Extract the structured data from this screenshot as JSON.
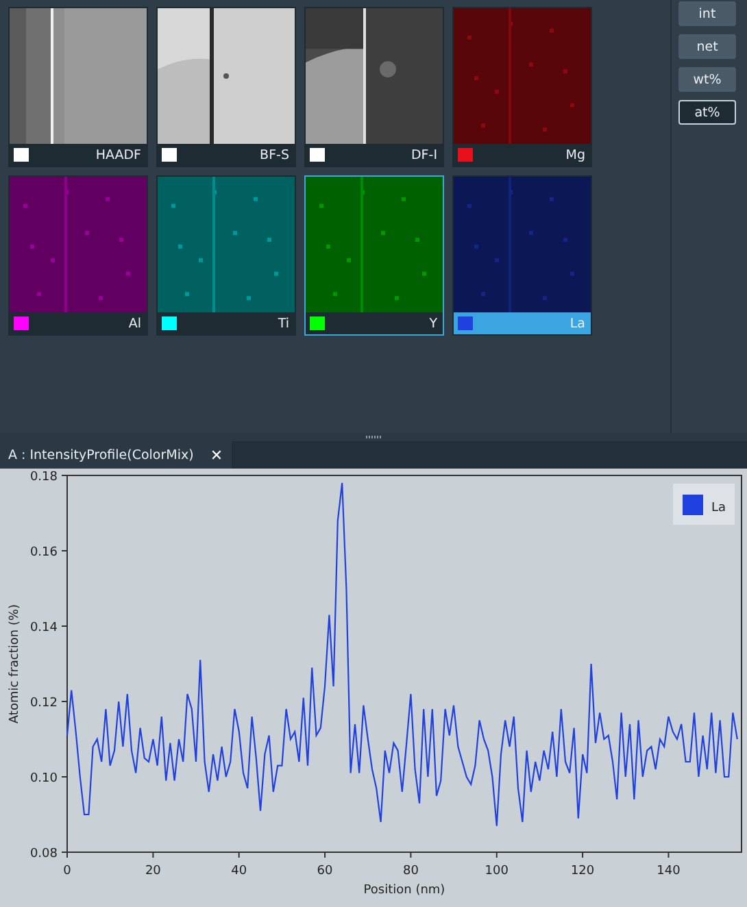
{
  "tiles": [
    {
      "label": "HAADF",
      "kind": "micrograph",
      "color": "#ffffff",
      "selected": false,
      "highlighted": false
    },
    {
      "label": "BF-S",
      "kind": "micrograph",
      "color": "#ffffff",
      "selected": false,
      "highlighted": false
    },
    {
      "label": "DF-I",
      "kind": "micrograph",
      "color": "#ffffff",
      "selected": false,
      "highlighted": false
    },
    {
      "label": "Mg",
      "kind": "element_map",
      "color": "#e8101a",
      "selected": false,
      "highlighted": false
    },
    {
      "label": "Al",
      "kind": "element_map",
      "color": "#ff00ff",
      "selected": false,
      "highlighted": false
    },
    {
      "label": "Ti",
      "kind": "element_map",
      "color": "#00ffff",
      "selected": false,
      "highlighted": false
    },
    {
      "label": "Y",
      "kind": "element_map",
      "color": "#00ff00",
      "selected": true,
      "highlighted": false
    },
    {
      "label": "La",
      "kind": "element_map",
      "color": "#2040e0",
      "selected": false,
      "highlighted": true
    }
  ],
  "sidebar": {
    "buttons": [
      {
        "label": "int",
        "selected": false
      },
      {
        "label": "net",
        "selected": false
      },
      {
        "label": "wt%",
        "selected": false
      },
      {
        "label": "at%",
        "selected": true
      }
    ]
  },
  "tab": {
    "title": "A : IntensityProfile(ColorMix)",
    "close": "✕"
  },
  "chart": {
    "chart_data": {
      "type": "line",
      "xlabel": "Position (nm)",
      "ylabel": "Atomic fraction (%)",
      "xlim": [
        0,
        157
      ],
      "ylim": [
        0.08,
        0.18
      ],
      "xticks": [
        0,
        20,
        40,
        60,
        80,
        100,
        120,
        140
      ],
      "yticks": [
        {
          "value": 0.08,
          "label": "0.08"
        },
        {
          "value": 0.1,
          "label": "0.10"
        },
        {
          "value": 0.12,
          "label": "0.12"
        },
        {
          "value": 0.14,
          "label": "0.14"
        },
        {
          "value": 0.16,
          "label": "0.16"
        },
        {
          "value": 0.18,
          "label": "0.18"
        }
      ],
      "x": [
        0,
        1,
        2,
        3,
        4,
        5,
        6,
        7,
        8,
        9,
        10,
        11,
        12,
        13,
        14,
        15,
        16,
        17,
        18,
        19,
        20,
        21,
        22,
        23,
        24,
        25,
        26,
        27,
        28,
        29,
        30,
        31,
        32,
        33,
        34,
        35,
        36,
        37,
        38,
        39,
        40,
        41,
        42,
        43,
        44,
        45,
        46,
        47,
        48,
        49,
        50,
        51,
        52,
        53,
        54,
        55,
        56,
        57,
        58,
        59,
        60,
        61,
        62,
        63,
        64,
        65,
        66,
        67,
        68,
        69,
        70,
        71,
        72,
        73,
        74,
        75,
        76,
        77,
        78,
        79,
        80,
        81,
        82,
        83,
        84,
        85,
        86,
        87,
        88,
        89,
        90,
        91,
        92,
        93,
        94,
        95,
        96,
        97,
        98,
        99,
        100,
        101,
        102,
        103,
        104,
        105,
        106,
        107,
        108,
        109,
        110,
        111,
        112,
        113,
        114,
        115,
        116,
        117,
        118,
        119,
        120,
        121,
        122,
        123,
        124,
        125,
        126,
        127,
        128,
        129,
        130,
        131,
        132,
        133,
        134,
        135,
        136,
        137,
        138,
        139,
        140,
        141,
        142,
        143,
        144,
        145,
        146,
        147,
        148,
        149,
        150,
        151,
        152,
        153,
        154,
        155,
        156
      ],
      "series": [
        {
          "name": "La",
          "color": "#2040e0",
          "values": [
            0.111,
            0.123,
            0.112,
            0.1,
            0.09,
            0.09,
            0.108,
            0.11,
            0.104,
            0.118,
            0.103,
            0.107,
            0.12,
            0.108,
            0.122,
            0.107,
            0.101,
            0.113,
            0.105,
            0.104,
            0.11,
            0.103,
            0.116,
            0.099,
            0.109,
            0.099,
            0.11,
            0.104,
            0.122,
            0.118,
            0.104,
            0.131,
            0.104,
            0.096,
            0.106,
            0.099,
            0.108,
            0.1,
            0.104,
            0.118,
            0.112,
            0.101,
            0.097,
            0.116,
            0.105,
            0.091,
            0.106,
            0.111,
            0.096,
            0.103,
            0.103,
            0.118,
            0.11,
            0.112,
            0.104,
            0.121,
            0.103,
            0.129,
            0.111,
            0.113,
            0.124,
            0.143,
            0.124,
            0.168,
            0.178,
            0.15,
            0.101,
            0.114,
            0.101,
            0.119,
            0.11,
            0.102,
            0.097,
            0.088,
            0.107,
            0.101,
            0.109,
            0.107,
            0.096,
            0.109,
            0.122,
            0.102,
            0.093,
            0.118,
            0.1,
            0.118,
            0.095,
            0.099,
            0.118,
            0.111,
            0.119,
            0.108,
            0.104,
            0.1,
            0.098,
            0.103,
            0.115,
            0.11,
            0.107,
            0.1,
            0.087,
            0.106,
            0.115,
            0.108,
            0.116,
            0.097,
            0.088,
            0.107,
            0.096,
            0.104,
            0.099,
            0.107,
            0.102,
            0.112,
            0.1,
            0.118,
            0.104,
            0.101,
            0.113,
            0.089,
            0.106,
            0.101,
            0.13,
            0.109,
            0.117,
            0.11,
            0.111,
            0.104,
            0.094,
            0.117,
            0.1,
            0.114,
            0.094,
            0.115,
            0.1,
            0.107,
            0.108,
            0.102,
            0.11,
            0.108,
            0.116,
            0.112,
            0.11,
            0.114,
            0.104,
            0.104,
            0.117,
            0.1,
            0.111,
            0.102,
            0.117,
            0.101,
            0.115,
            0.1,
            0.1,
            0.117,
            0.11
          ]
        }
      ]
    }
  }
}
